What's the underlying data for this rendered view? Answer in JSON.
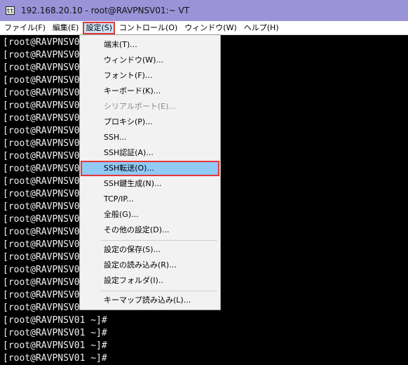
{
  "window": {
    "title": "192.168.20.10 - root@RAVPNSV01:~ VT",
    "icon": "tt"
  },
  "menubar": {
    "items": [
      {
        "label": "ファイル(F)"
      },
      {
        "label": "編集(E)"
      },
      {
        "label": "設定(S)"
      },
      {
        "label": "コントロール(O)"
      },
      {
        "label": "ウィンドウ(W)"
      },
      {
        "label": "ヘルプ(H)"
      }
    ]
  },
  "dropdown": {
    "items": [
      {
        "label": "端末(T)..."
      },
      {
        "label": "ウィンドウ(W)..."
      },
      {
        "label": "フォント(F)..."
      },
      {
        "label": "キーボード(K)..."
      },
      {
        "label": "シリアルポート(E)...",
        "disabled": true
      },
      {
        "label": "プロキシ(P)..."
      },
      {
        "label": "SSH..."
      },
      {
        "label": "SSH認証(A)..."
      },
      {
        "label": "SSH転送(O)...",
        "highlighted": true
      },
      {
        "label": "SSH鍵生成(N)..."
      },
      {
        "label": "TCP/IP..."
      },
      {
        "label": "全般(G)..."
      },
      {
        "label": "その他の設定(D)..."
      },
      {
        "label": "設定の保存(S)..."
      },
      {
        "label": "設定の読み込み(R)..."
      },
      {
        "label": "設定フォルダ(I).."
      },
      {
        "label": "キーマップ読み込み(L)..."
      }
    ]
  },
  "terminal": {
    "lines": [
      "[root@RAVPNSV0",
      "[root@RAVPNSV0",
      "[root@RAVPNSV0",
      "[root@RAVPNSV0",
      "[root@RAVPNSV0",
      "[root@RAVPNSV0",
      "[root@RAVPNSV0",
      "[root@RAVPNSV0",
      "[root@RAVPNSV0",
      "[root@RAVPNSV0",
      "[root@RAVPNSV0",
      "[root@RAVPNSV0",
      "[root@RAVPNSV0",
      "[root@RAVPNSV0",
      "[root@RAVPNSV0",
      "[root@RAVPNSV0",
      "[root@RAVPNSV0",
      "[root@RAVPNSV0",
      "[root@RAVPNSV0",
      "[root@RAVPNSV0",
      "[root@RAVPNSV0",
      "[root@RAVPNSV0",
      "[root@RAVPNSV01 ~]#",
      "[root@RAVPNSV01 ~]#",
      "[root@RAVPNSV01 ~]#",
      "[root@RAVPNSV01 ~]#"
    ]
  },
  "colors": {
    "titlebar": "#9a93d8",
    "highlight": "#91c9f7",
    "annotation_border": "#e53838",
    "terminal_bg": "#000000",
    "terminal_fg": "#f0f0f0"
  }
}
